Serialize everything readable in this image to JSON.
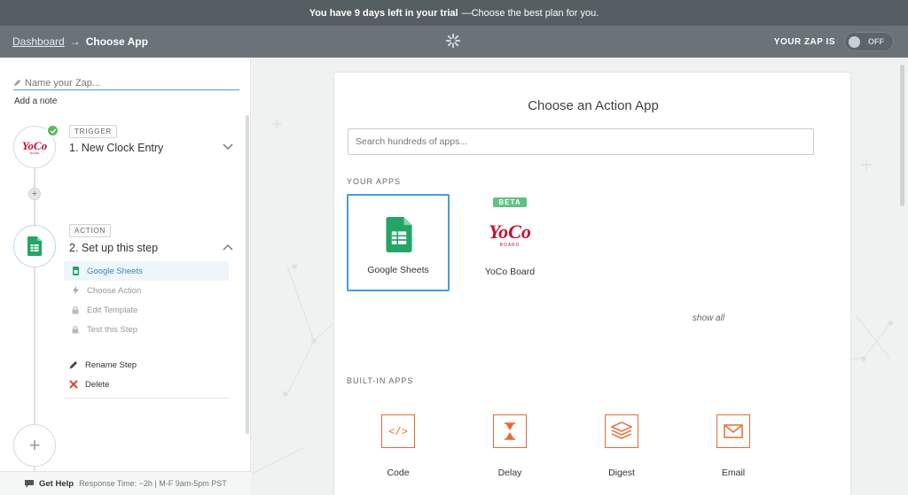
{
  "trial": {
    "bold": "You have 9 days left in your trial",
    "rest": "—Choose the best plan for you."
  },
  "header": {
    "breadcrumb_link": "Dashboard",
    "breadcrumb_arrow": "→",
    "breadcrumb_current": "Choose App",
    "zap_status_label": "YOUR ZAP IS",
    "toggle_state": "OFF"
  },
  "sidebar": {
    "zap_name_placeholder": "Name your Zap...",
    "add_note": "Add a note",
    "trigger": {
      "tag": "TRIGGER",
      "title": "1. New Clock Entry",
      "app_icon": "yoco-logo"
    },
    "action": {
      "tag": "ACTION",
      "title": "2. Set up this step",
      "app_icon": "google-sheets-icon"
    },
    "substeps": [
      {
        "label": "Google Sheets",
        "icon": "sheets-mini-icon",
        "active": true
      },
      {
        "label": "Choose Action",
        "icon": "bolt-icon",
        "active": false
      },
      {
        "label": "Edit Template",
        "icon": "lock-icon",
        "active": false
      },
      {
        "label": "Test this Step",
        "icon": "lock-icon",
        "active": false
      }
    ],
    "actions": [
      {
        "label": "Rename Step",
        "icon": "pencil-icon"
      },
      {
        "label": "Delete",
        "icon": "delete-x-icon"
      }
    ],
    "help": {
      "label": "Get Help",
      "info": "Response Time: ~2h | M-F 9am-5pm PST"
    }
  },
  "panel": {
    "title": "Choose an Action App",
    "search_placeholder": "Search hundreds of apps...",
    "your_apps_label": "YOUR APPS",
    "your_apps": [
      {
        "name": "Google Sheets",
        "selected": true
      },
      {
        "name": "YoCo Board",
        "badge": "BETA",
        "selected": false
      }
    ],
    "show_all": "show all",
    "builtin_label": "BUILT-IN APPS",
    "builtin_apps": [
      {
        "name": "Code",
        "icon": "code-icon"
      },
      {
        "name": "Delay",
        "icon": "hourglass-icon"
      },
      {
        "name": "Digest",
        "icon": "layers-icon"
      },
      {
        "name": "Email",
        "icon": "envelope-icon"
      }
    ]
  },
  "colors": {
    "accent_blue": "#4a9bd8",
    "builtin_orange": "#e76b32",
    "sheets_green": "#23a566",
    "yoco_red": "#c8102e"
  }
}
